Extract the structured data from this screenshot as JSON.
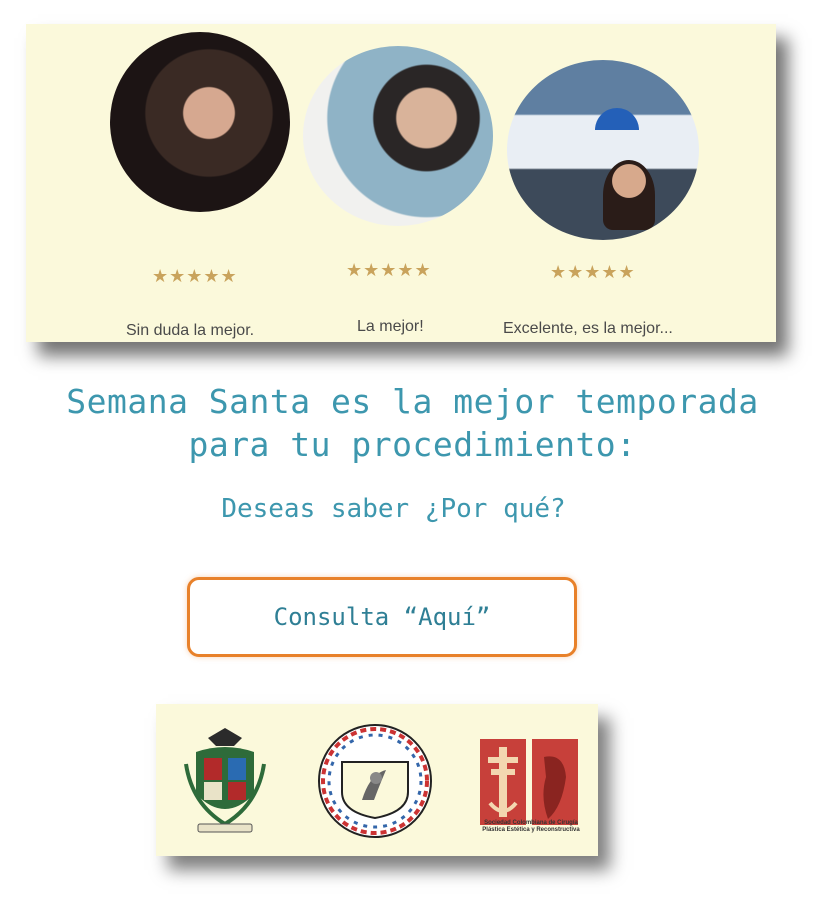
{
  "testimonials": {
    "items": [
      {
        "stars": "★★★★★",
        "rating": 5,
        "caption": "Sin duda la mejor."
      },
      {
        "stars": "★★★★★",
        "rating": 5,
        "caption": "La mejor!"
      },
      {
        "stars": "★★★★★",
        "rating": 5,
        "caption": "Excelente, es la mejor..."
      }
    ]
  },
  "headline": {
    "line1": "Semana Santa es la mejor temporada",
    "line2": "para tu procedimiento:"
  },
  "subhead": "Deseas saber ¿Por qué?",
  "cta": {
    "label": "Consulta “Aquí”"
  },
  "logos": {
    "items": [
      {
        "name": "university-crest-logo"
      },
      {
        "name": "federacion-ibero-latinoamericana-logo"
      },
      {
        "name": "sociedad-colombiana-cirugia-plastica-logo",
        "text": "Sociedad Colombiana de Cirugía Plástica Estética y Reconstructiva"
      }
    ]
  },
  "colors": {
    "accent_text": "#3d97ae",
    "cta_border": "#e8812a",
    "panel_bg": "#fbf9db",
    "star": "#c9a35c"
  }
}
